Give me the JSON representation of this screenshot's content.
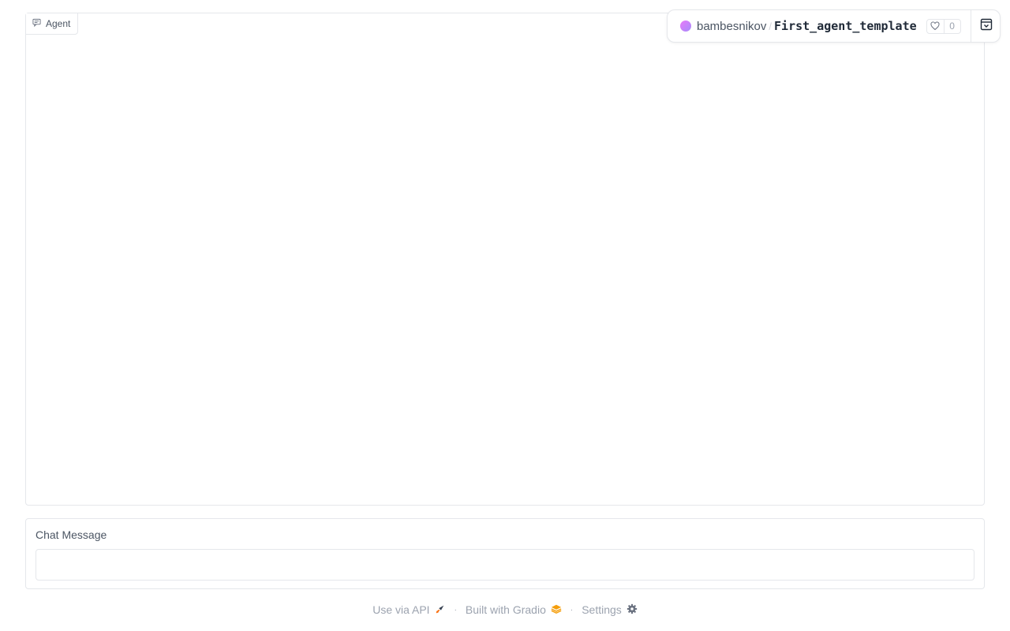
{
  "chatbot": {
    "label": "Agent",
    "icon": "chat-icon"
  },
  "header": {
    "owner": "bambesnikov",
    "separator": "/",
    "repo": "First_agent_template",
    "like_count": "0",
    "like_icon": "heart-icon",
    "collapse_icon": "collapse-icon"
  },
  "chat_input": {
    "label": "Chat Message",
    "value": "",
    "placeholder": ""
  },
  "footer": {
    "api_label": "Use via API",
    "gradio_label": "Built with Gradio",
    "settings_label": "Settings",
    "separator": "·"
  },
  "colors": {
    "border": "#e5e7eb",
    "muted_text": "#9ca3af",
    "gradio_orange": "#f59e0b"
  }
}
